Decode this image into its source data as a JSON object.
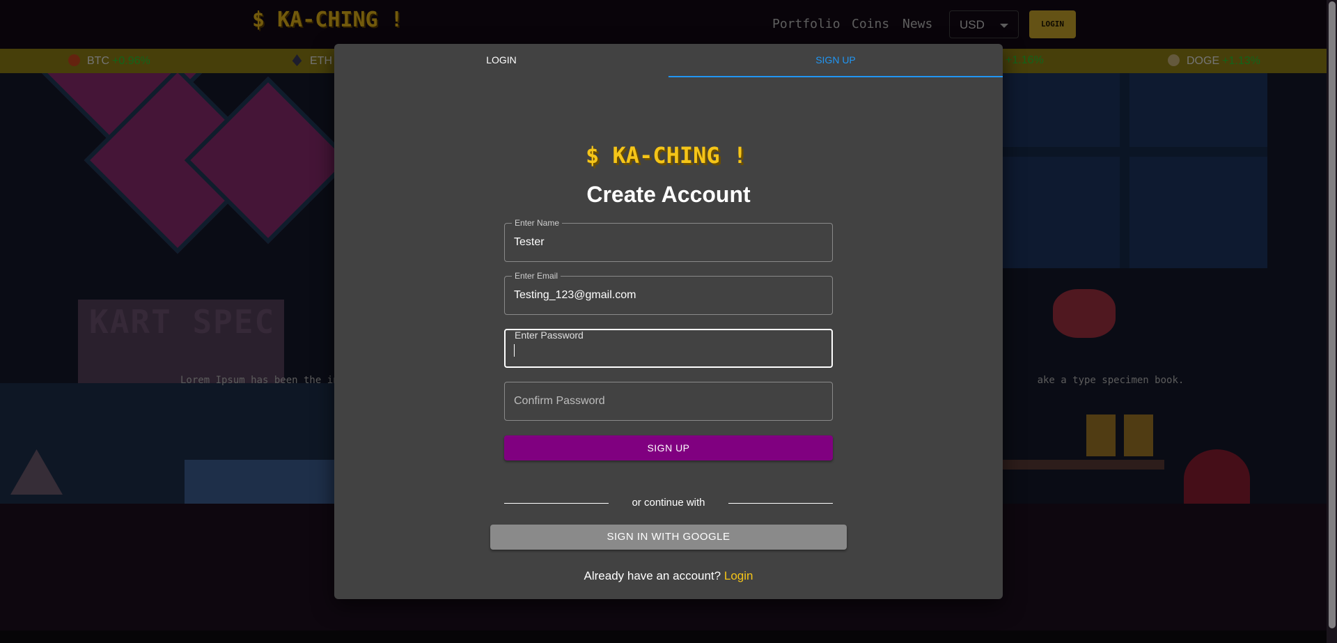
{
  "navbar": {
    "logo_text": "$ KA-CHING !",
    "links": [
      "Portfolio",
      "Coins",
      "News"
    ],
    "currency": "USD",
    "login_label": "LOGIN"
  },
  "ticker": [
    {
      "symbol": "BTC",
      "change": "+0.96%"
    },
    {
      "symbol": "ETH",
      "change": ""
    },
    {
      "symbol": "",
      "change": "+1.16%"
    },
    {
      "symbol": "DOGE",
      "change": "+1.13%"
    }
  ],
  "hero": {
    "sign_text": "KART SPEC",
    "lorem_left": "Lorem Ipsum has been the in",
    "lorem_right": "ake a type specimen book."
  },
  "dialog": {
    "tabs": {
      "login": "LOGIN",
      "signup": "SIGN UP"
    },
    "logo_text": "$ KA-CHING !",
    "heading": "Create Account",
    "fields": {
      "name": {
        "label": "Enter Name",
        "value": "Tester"
      },
      "email": {
        "label": "Enter Email",
        "value": "Testing_123@gmail.com"
      },
      "password": {
        "label": "Enter Password",
        "value": ""
      },
      "confirm": {
        "placeholder": "Confirm Password"
      }
    },
    "signup_button": "SIGN UP",
    "divider_text": "or continue with",
    "google_button": "SIGN IN WITH GOOGLE",
    "footer": {
      "prompt": "Already have an account?",
      "link": "Login"
    }
  },
  "colors": {
    "accent_blue": "#2196f3",
    "signup_purple": "#800080",
    "logo_yellow": "#f5c518",
    "ticker_green": "#22c934",
    "ticker_bg": "#8f7f14"
  },
  "icons": {
    "btc": "bitcoin-icon",
    "eth": "ethereum-icon",
    "doge": "dogecoin-icon"
  }
}
